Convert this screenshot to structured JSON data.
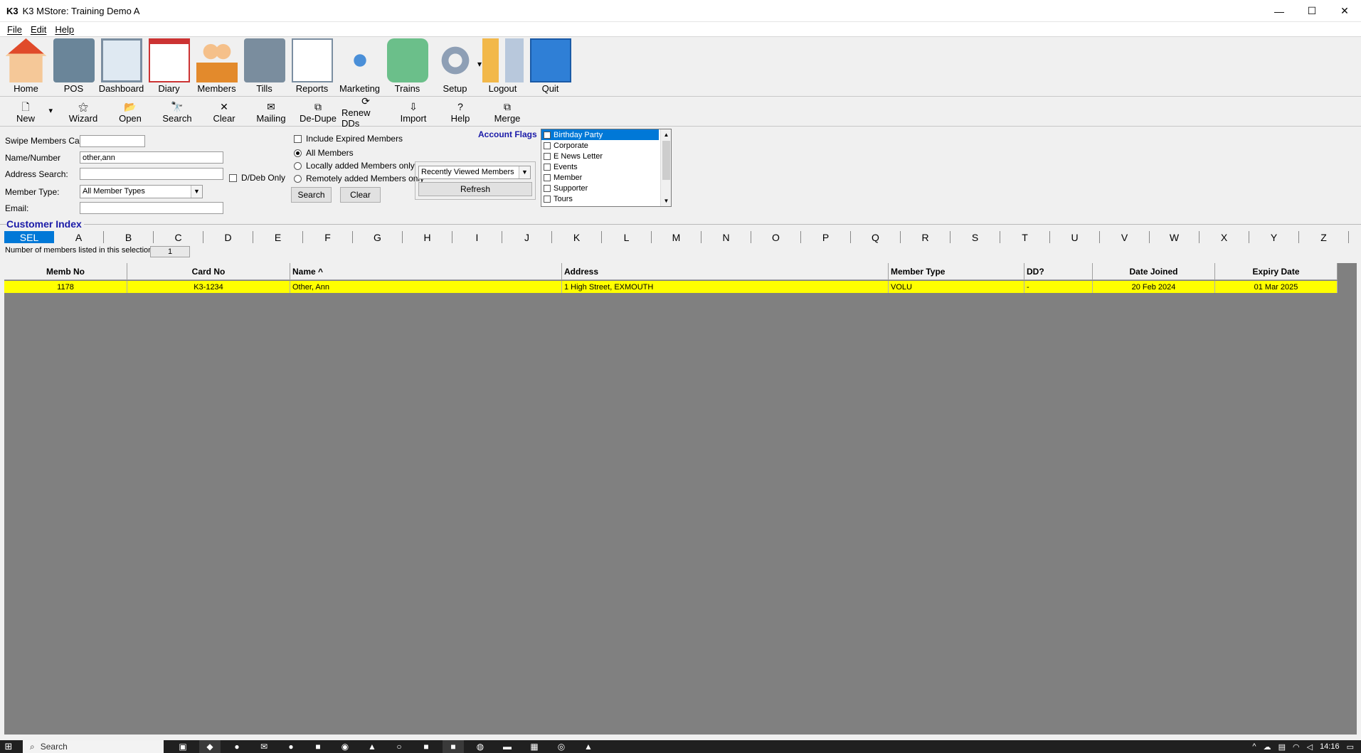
{
  "window": {
    "logo": "K3",
    "title": "K3 MStore: Training Demo A",
    "minimize_glyph": "—",
    "maximize_glyph": "☐",
    "close_glyph": "✕"
  },
  "menu": [
    "File",
    "Edit",
    "Help"
  ],
  "main_toolbar": [
    {
      "label": "Home",
      "icon": "home-icon"
    },
    {
      "label": "POS",
      "icon": "pos-icon"
    },
    {
      "label": "Dashboard",
      "icon": "dashboard-icon"
    },
    {
      "label": "Diary",
      "icon": "diary-icon"
    },
    {
      "label": "Members",
      "icon": "members-icon"
    },
    {
      "label": "Tills",
      "icon": "tills-icon"
    },
    {
      "label": "Reports",
      "icon": "reports-icon"
    },
    {
      "label": "Marketing",
      "icon": "marketing-icon"
    },
    {
      "label": "Trains",
      "icon": "trains-icon"
    },
    {
      "label": "Setup",
      "icon": "setup-icon"
    },
    {
      "label": "Logout",
      "icon": "logout-icon"
    },
    {
      "label": "Quit",
      "icon": "quit-icon"
    }
  ],
  "secondary_toolbar": [
    {
      "label": "New",
      "glyph": "🗋"
    },
    {
      "label": "Wizard",
      "glyph": "⚝"
    },
    {
      "label": "Open",
      "glyph": "📂"
    },
    {
      "label": "Search",
      "glyph": "🔭"
    },
    {
      "label": "Clear",
      "glyph": "✕"
    },
    {
      "label": "Mailing",
      "glyph": "✉"
    },
    {
      "label": "De-Dupe",
      "glyph": "⧉"
    },
    {
      "label": "Renew DDs",
      "glyph": "⟳"
    },
    {
      "label": "Import",
      "glyph": "⇩"
    },
    {
      "label": "Help",
      "glyph": "?"
    },
    {
      "label": "Merge",
      "glyph": "⧉"
    }
  ],
  "search": {
    "swipe_label": "Swipe Members Card:",
    "swipe_value": "",
    "name_label": "Name/Number",
    "name_value": "other,ann",
    "address_label": "Address Search:",
    "address_value": "",
    "member_type_label": "Member Type:",
    "member_type_value": "All Member Types",
    "email_label": "Email:",
    "email_value": "",
    "ddeb_label": "D/Deb Only",
    "include_expired_label": "Include Expired Members",
    "radio_all": "All Members",
    "radio_local": "Locally added Members only",
    "radio_remote": "Remotely added Members only",
    "search_button": "Search",
    "clear_button": "Clear",
    "recent_select": "Recently Viewed Members",
    "refresh_button": "Refresh"
  },
  "account_flags": {
    "title": "Account Flags",
    "items": [
      "Birthday Party",
      "Corporate",
      "E News Letter",
      "Events",
      "Member",
      "Supporter",
      "Tours"
    ],
    "selected": "Birthday Party"
  },
  "customer_index": {
    "title": "Customer Index",
    "letters": [
      "SEL",
      "A",
      "B",
      "C",
      "D",
      "E",
      "F",
      "G",
      "H",
      "I",
      "J",
      "K",
      "L",
      "M",
      "N",
      "O",
      "P",
      "Q",
      "R",
      "S",
      "T",
      "U",
      "V",
      "W",
      "X",
      "Y",
      "Z"
    ],
    "count_label": "Number of members listed in this selection:",
    "count_value": "1"
  },
  "table": {
    "columns": [
      "Memb No",
      "Card No",
      "Name ^",
      "Address",
      "Member Type",
      "DD?",
      "Date Joined",
      "Expiry Date"
    ],
    "rows": [
      [
        "1178",
        "K3-1234",
        "Other, Ann",
        "1 High Street, EXMOUTH",
        "VOLU",
        "-",
        "20 Feb 2024",
        "01 Mar 2025"
      ]
    ]
  },
  "taskbar": {
    "search_placeholder": "Search",
    "time": "14:16"
  }
}
